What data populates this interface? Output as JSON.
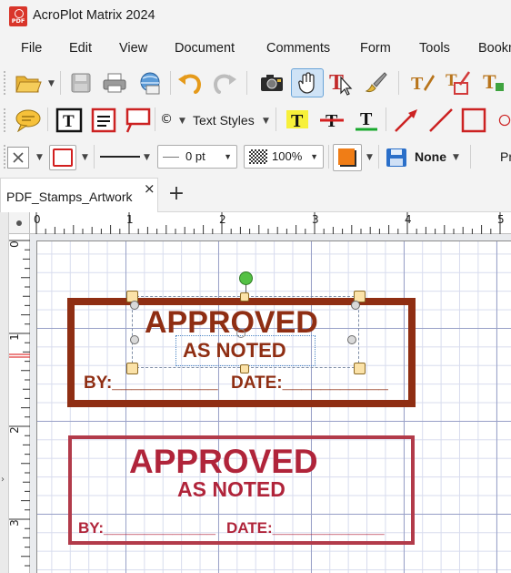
{
  "window": {
    "title": "AcroPlot Matrix 2024"
  },
  "menu": [
    "File",
    "Edit",
    "View",
    "Document",
    "Comments",
    "Form",
    "Tools",
    "Bookm"
  ],
  "toolbar3": {
    "line_width_value": "0 pt",
    "opacity_value": "100%",
    "style_value": "None",
    "trailing_label": "Pr"
  },
  "toolbar2": {
    "text_styles_label": "Text Styles",
    "copyright_glyph": "©"
  },
  "tab": {
    "document_name": "PDF_Stamps_Artwork",
    "close_glyph": "×",
    "new_glyph": "+"
  },
  "ruler": {
    "h_numbers": [
      "0",
      "1",
      "2",
      "3",
      "4",
      "5"
    ],
    "v_numbers": [
      "0",
      "1",
      "2",
      "3"
    ]
  },
  "stamps": [
    {
      "line1": "APPROVED",
      "line2": "AS NOTED",
      "by": "BY:___________",
      "date": "DATE:___________"
    },
    {
      "line1": "APPROVED",
      "line2": "AS NOTED",
      "by": "BY:_____________",
      "date": "DATE:_____________"
    }
  ],
  "colors": {
    "stamp1": "#8f2e13",
    "stamp2": "#b0243a",
    "selection_handle": "#fbe2a8",
    "rotation_handle": "#54c144",
    "accent_blue": "#2a6fc9"
  }
}
